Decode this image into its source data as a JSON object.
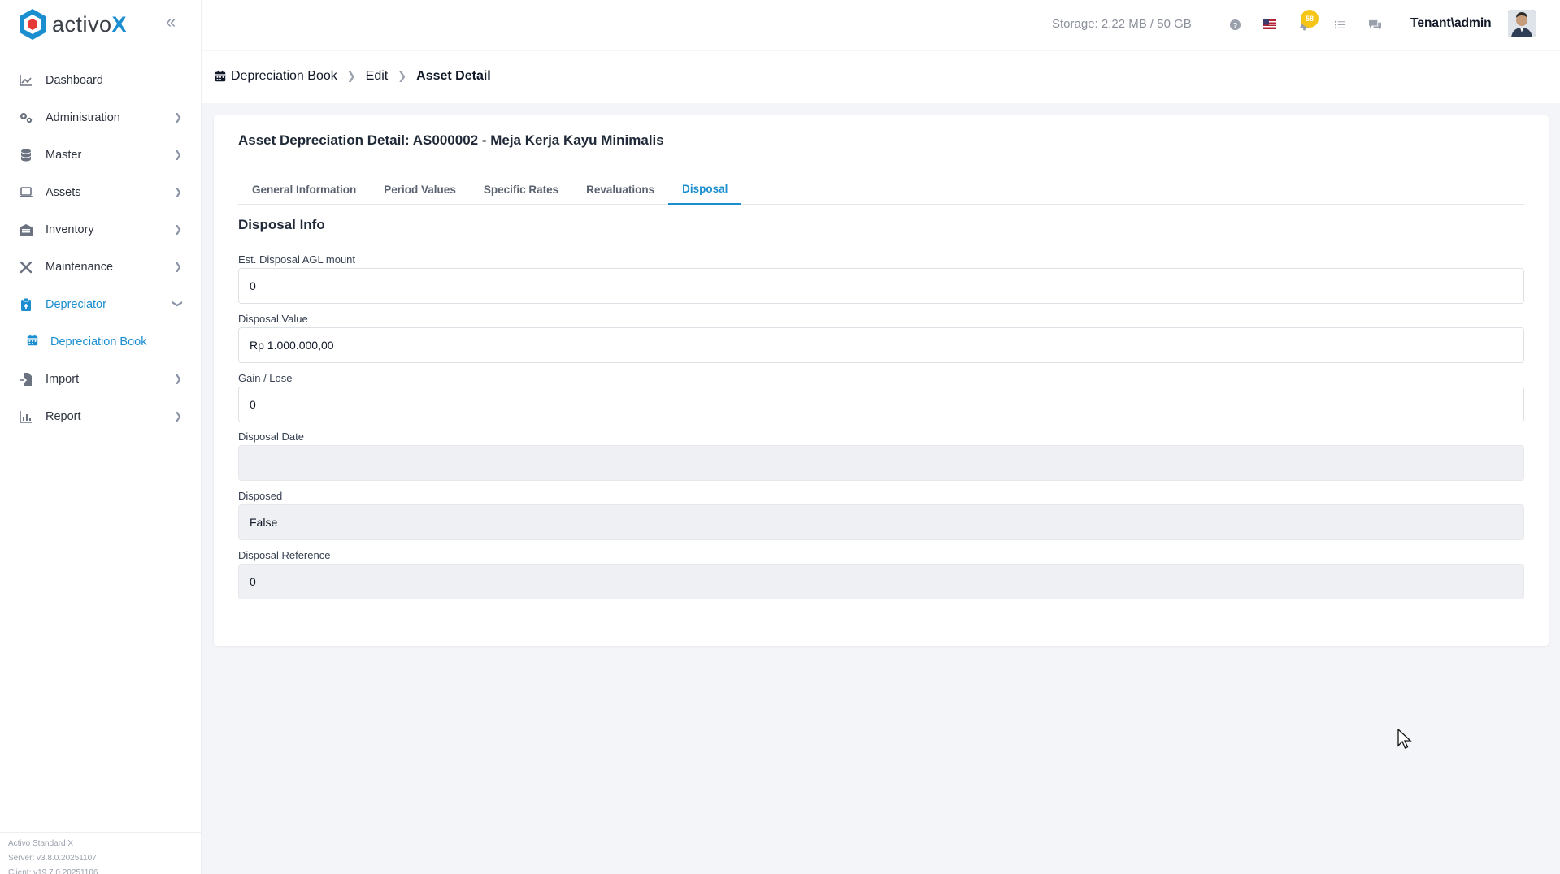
{
  "app": {
    "brand_prefix": "activo",
    "brand_x": "X",
    "accent_color": "#1b8ed0"
  },
  "sidebar": {
    "items": [
      {
        "label": "Dashboard",
        "icon": "chart-line-icon",
        "has_children": false
      },
      {
        "label": "Administration",
        "icon": "gears-icon",
        "has_children": true
      },
      {
        "label": "Master",
        "icon": "database-icon",
        "has_children": true
      },
      {
        "label": "Assets",
        "icon": "laptop-icon",
        "has_children": true
      },
      {
        "label": "Inventory",
        "icon": "warehouse-icon",
        "has_children": true
      },
      {
        "label": "Maintenance",
        "icon": "tools-icon",
        "has_children": true
      },
      {
        "label": "Depreciator",
        "icon": "clipboard-icon",
        "has_children": true,
        "expanded": true,
        "active": true
      },
      {
        "label": "Import",
        "icon": "file-import-icon",
        "has_children": true
      },
      {
        "label": "Report",
        "icon": "bar-chart-icon",
        "has_children": true
      }
    ],
    "sub_items": [
      {
        "label": "Depreciation Book",
        "icon": "calendar-icon",
        "active": true
      }
    ],
    "footer": {
      "edition": "Activo Standard X",
      "server": "Server: v3.8.0.20251107",
      "client": "Client: v19.7.0.20251106"
    }
  },
  "topbar": {
    "storage": "Storage: 2.22 MB / 50 GB",
    "notification_count": "58",
    "user": "Tenant\\admin"
  },
  "breadcrumb": {
    "items": [
      "Depreciation Book",
      "Edit",
      "Asset Detail"
    ]
  },
  "card": {
    "title": "Asset Depreciation Detail: AS000002 - Meja Kerja Kayu Minimalis",
    "tabs": [
      {
        "label": "General Information",
        "active": false
      },
      {
        "label": "Period Values",
        "active": false
      },
      {
        "label": "Specific Rates",
        "active": false
      },
      {
        "label": "Revaluations",
        "active": false
      },
      {
        "label": "Disposal",
        "active": true
      }
    ],
    "section_title": "Disposal Info",
    "fields": [
      {
        "label": "Est. Disposal AGL mount",
        "value": "0",
        "readonly": false
      },
      {
        "label": "Disposal Value",
        "value": "Rp 1.000.000,00",
        "readonly": false
      },
      {
        "label": "Gain / Lose",
        "value": "0",
        "readonly": false
      },
      {
        "label": "Disposal Date",
        "value": "",
        "readonly": true
      },
      {
        "label": "Disposed",
        "value": "False",
        "readonly": true
      },
      {
        "label": "Disposal Reference",
        "value": "0",
        "readonly": true
      }
    ]
  }
}
